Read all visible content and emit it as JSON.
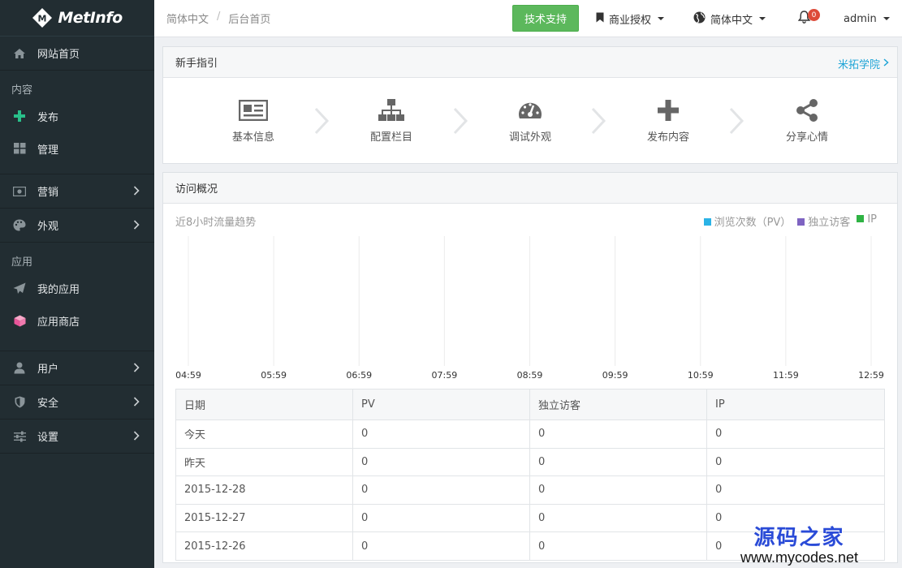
{
  "brand": {
    "name": "MetInfo",
    "mark_letter": "M"
  },
  "sidebar": {
    "home": "网站首页",
    "section_content": "内容",
    "publish": "发布",
    "manage": "管理",
    "marketing": "营销",
    "appearance": "外观",
    "section_apps": "应用",
    "my_apps": "我的应用",
    "app_store": "应用商店",
    "users": "用户",
    "security": "安全",
    "settings": "设置"
  },
  "header": {
    "breadcrumb": [
      "简体中文",
      "后台首页"
    ],
    "breadcrumb_sep": "/",
    "tech_support": "技术支持",
    "license": "商业授权",
    "language": "简体中文",
    "notification_count": "0",
    "user": "admin"
  },
  "guide": {
    "title": "新手指引",
    "more_link": "米拓学院",
    "steps": [
      "基本信息",
      "配置栏目",
      "调试外观",
      "发布内容",
      "分享心情"
    ]
  },
  "visits": {
    "title": "访问概况",
    "subtitle": "近8小时流量趋势",
    "legend": [
      "浏览次数（PV）",
      "独立访客",
      "IP"
    ],
    "legend_colors": [
      "#2bb3e6",
      "#7e63c1",
      "#2fb344"
    ],
    "table_headers": [
      "日期",
      "PV",
      "独立访客",
      "IP"
    ],
    "rows": [
      [
        "今天",
        "0",
        "0",
        "0"
      ],
      [
        "昨天",
        "0",
        "0",
        "0"
      ],
      [
        "2015-12-28",
        "0",
        "0",
        "0"
      ],
      [
        "2015-12-27",
        "0",
        "0",
        "0"
      ],
      [
        "2015-12-26",
        "0",
        "0",
        "0"
      ]
    ]
  },
  "chart_data": {
    "type": "line",
    "x": [
      "04:59",
      "05:59",
      "06:59",
      "07:59",
      "08:59",
      "09:59",
      "10:59",
      "11:59",
      "12:59"
    ],
    "series": [
      {
        "name": "浏览次数（PV）",
        "values": []
      },
      {
        "name": "独立访客",
        "values": []
      },
      {
        "name": "IP",
        "values": []
      }
    ],
    "grid": true,
    "legend": "top-right"
  },
  "watermark": {
    "cn": "源码之家",
    "url": "www.mycodes.net"
  },
  "colors": {
    "sidebar": "#222d32",
    "accent_green": "#5cb85c",
    "link_blue": "#1ea4d6",
    "badge_red": "#dd4b39"
  }
}
